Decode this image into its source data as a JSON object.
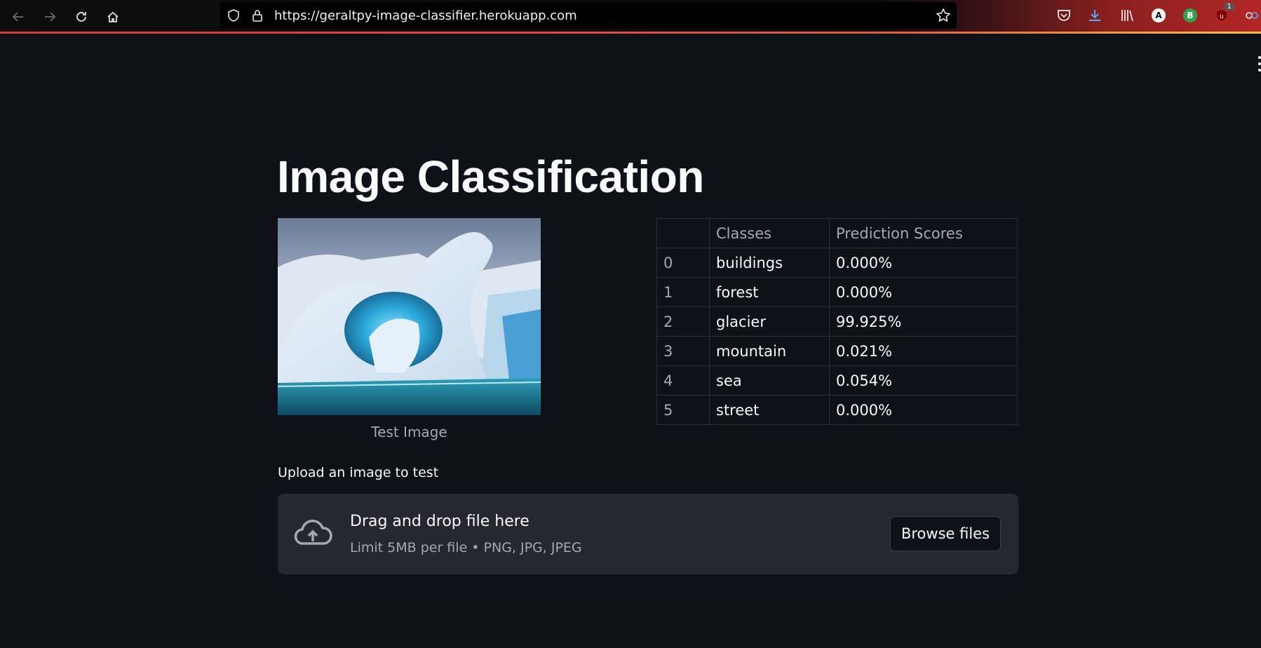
{
  "browser": {
    "url": "https://geraltpy-image-classifier.herokuapp.com",
    "extension_badge": "1",
    "avatar_a": "A",
    "avatar_b": "B"
  },
  "app": {
    "title": "Image Classification",
    "image_caption": "Test Image",
    "table": {
      "headers": [
        "",
        "Classes",
        "Prediction Scores"
      ],
      "rows": [
        {
          "index": "0",
          "class": "buildings",
          "score": "0.000%"
        },
        {
          "index": "1",
          "class": "forest",
          "score": "0.000%"
        },
        {
          "index": "2",
          "class": "glacier",
          "score": "99.925%"
        },
        {
          "index": "3",
          "class": "mountain",
          "score": "0.021%"
        },
        {
          "index": "4",
          "class": "sea",
          "score": "0.054%"
        },
        {
          "index": "5",
          "class": "street",
          "score": "0.000%"
        }
      ]
    },
    "upload": {
      "label": "Upload an image to test",
      "drop_title": "Drag and drop file here",
      "limit_text": "Limit 5MB per file • PNG, JPG, JPEG",
      "browse_label": "Browse files"
    }
  },
  "colors": {
    "background": "#0e1117",
    "dropzone": "#262730",
    "muted_text": "#a3a8b4",
    "accent_red": "#d83a2b"
  }
}
